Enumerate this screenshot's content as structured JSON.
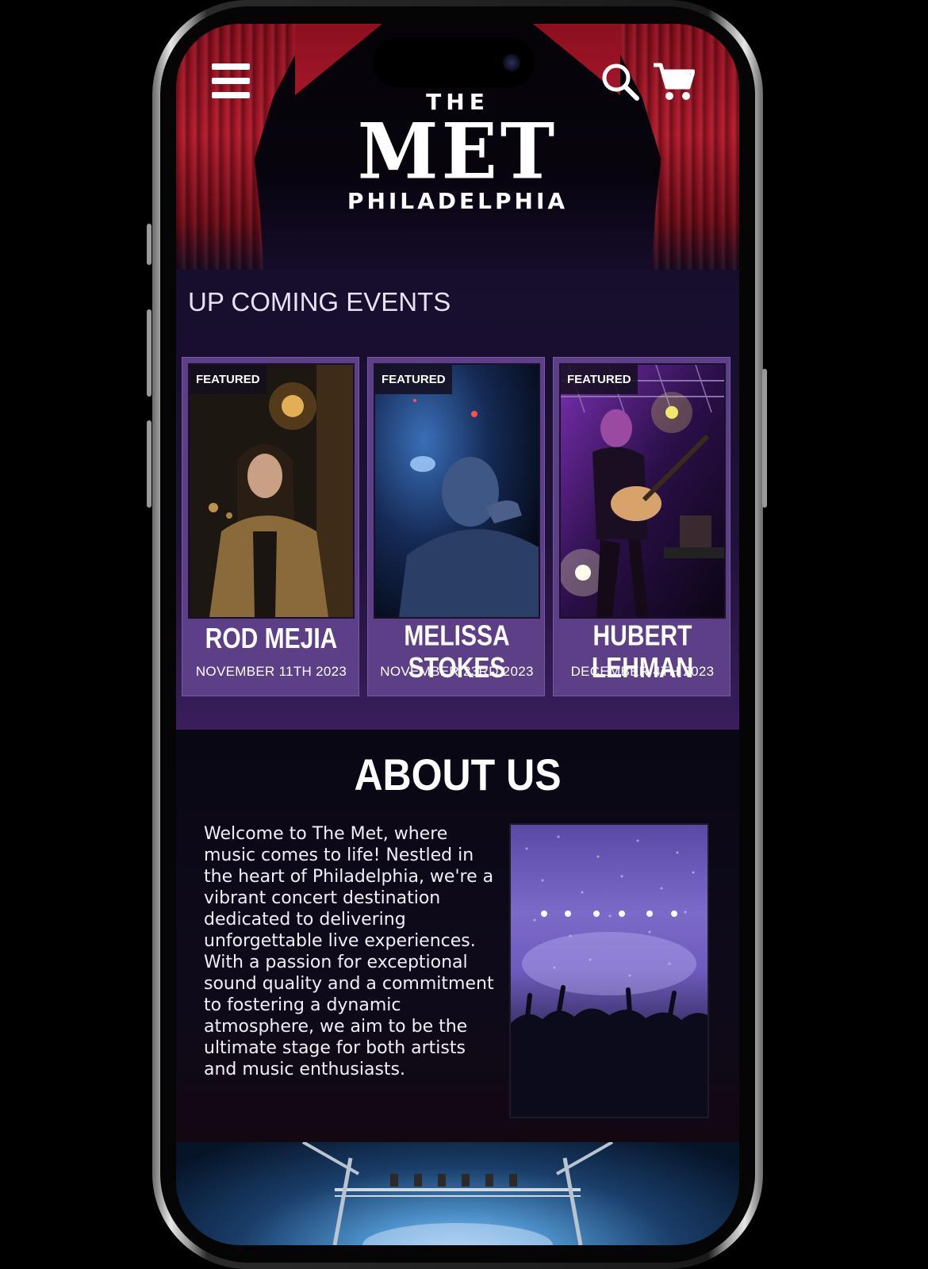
{
  "header": {
    "logo_the": "THE",
    "logo_met": "MET",
    "logo_city": "PHILADELPHIA"
  },
  "icons": {
    "menu": "hamburger-menu-icon",
    "search": "search-icon",
    "cart": "shopping-cart-icon"
  },
  "events": {
    "heading": "UP COMING EVENTS",
    "cards": [
      {
        "badge": "FEATURED",
        "name": "ROD MEJIA",
        "date": "NOVEMBER 11TH 2023"
      },
      {
        "badge": "FEATURED",
        "name": "MELISSA STOKES",
        "date": "NOVEMBER 23RD 2023"
      },
      {
        "badge": "FEATURED",
        "name": "HUBERT LEHMAN",
        "date": "DECEMBER 4TH 2023"
      }
    ]
  },
  "about": {
    "title": "ABOUT US",
    "body": "Welcome to The Met, where music comes to life! Nestled in the heart of Philadelphia, we're a vibrant concert destination dedicated to delivering unforgettable live experiences. With a passion for exceptional sound quality and a commitment to fostering a dynamic atmosphere, we aim to be the ultimate stage for both artists and music enthusiasts."
  },
  "colors": {
    "curtain_red": "#b0182a",
    "card_purple": "#5c3f86",
    "background_dark": "#0d0818"
  }
}
